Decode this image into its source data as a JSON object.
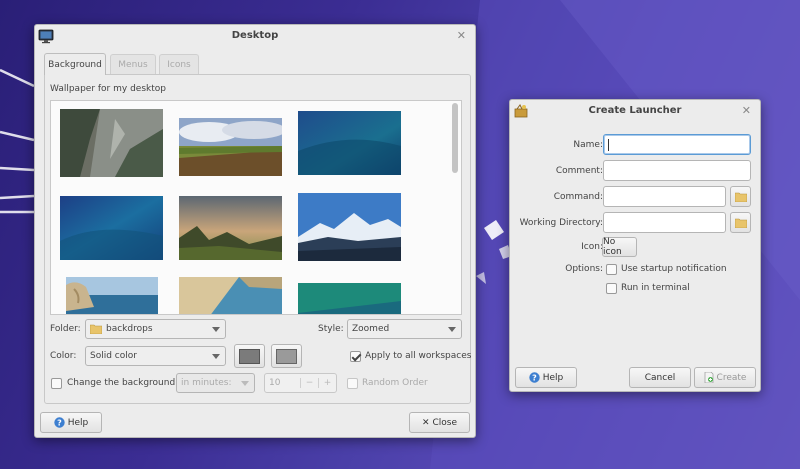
{
  "desktop_window": {
    "title": "Desktop",
    "tabs": [
      {
        "label": "Background"
      },
      {
        "label": "Menus"
      },
      {
        "label": "Icons"
      }
    ],
    "wallpaper_label": "Wallpaper for my desktop",
    "folder_label": "Folder:",
    "folder_value": "backdrops",
    "style_label": "Style:",
    "style_value": "Zoomed",
    "color_label": "Color:",
    "color_value": "Solid color",
    "color_swatch_1": "#7b7b7b",
    "color_swatch_2": "#9a9a9a",
    "apply_all_label": "Apply to all workspaces",
    "change_bg_label": "Change the background",
    "interval_unit": "in minutes:",
    "interval_value": "10",
    "random_order_label": "Random Order",
    "help_label": "Help",
    "close_label": "Close"
  },
  "launcher_window": {
    "title": "Create Launcher",
    "name_label": "Name:",
    "comment_label": "Comment:",
    "command_label": "Command:",
    "workdir_label": "Working Directory:",
    "icon_label": "Icon:",
    "icon_button": "No icon",
    "options_label": "Options:",
    "startup_label": "Use startup notification",
    "terminal_label": "Run in terminal",
    "help_label": "Help",
    "cancel_label": "Cancel",
    "create_label": "Create"
  }
}
